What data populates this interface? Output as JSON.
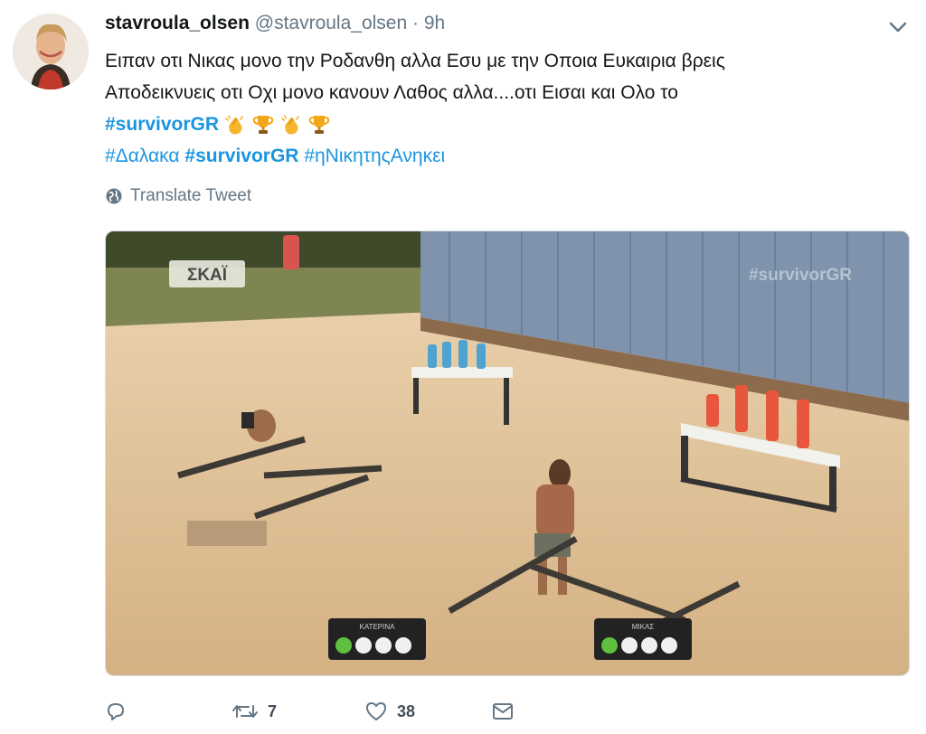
{
  "tweet": {
    "display_name": "stavroula_olsen",
    "handle": "@stavroula_olsen",
    "separator": "·",
    "time": "9h",
    "text_line1": "Ειπαν οτι Νικας μονο την Ροδανθη αλλα Εσυ με την Οποια Ευκαιρια βρεις",
    "text_line2": "Αποδεικνυεις οτι Οχι μονο κανουν Λαθος αλλα....οτι Εισαι και Ολο το",
    "hashtag_line3": "#survivorGR",
    "emojis_line3": [
      "clapping-hands-icon",
      "trophy-icon",
      "clapping-hands-icon",
      "trophy-icon"
    ],
    "hashtags_line4": [
      "#Δαλακα",
      "#survivorGR",
      "#ηΝικητηςΑνηκει"
    ],
    "translate_label": "Translate Tweet",
    "media": {
      "channel_logo": "ΣΚΑΪ",
      "watermark": "#survivorGR",
      "scoreboard_left_label": "ΚΑΤΕΡΙΝΑ",
      "scoreboard_right_label": "ΜΙΚΑΣ"
    },
    "actions": {
      "reply_count": "",
      "retweet_count": "7",
      "like_count": "38"
    }
  },
  "colors": {
    "link": "#1b95e0",
    "muted": "#657786",
    "sand": "#d9b98d",
    "wall": "#7f93ad"
  }
}
